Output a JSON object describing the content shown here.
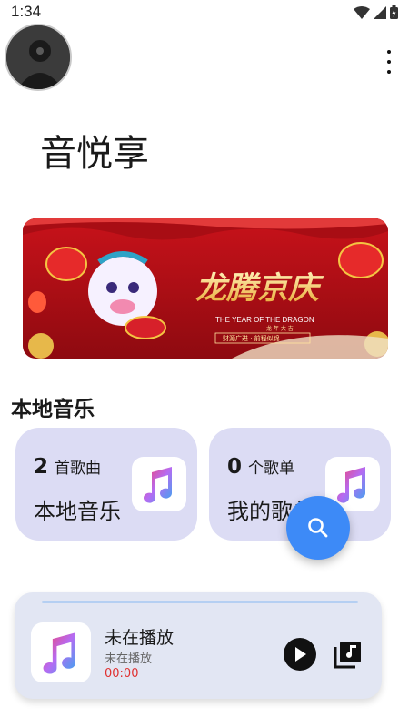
{
  "status_bar": {
    "time": "1:34"
  },
  "header": {
    "app_title": "音悦享"
  },
  "banner": {
    "headline": "龙腾京庆",
    "subtitle_en": "THE YEAR OF THE DRAGON",
    "subtitle_cn": "龙 年 大 吉",
    "slogan": "财源广进 · 前程似锦"
  },
  "local_section": {
    "title": "本地音乐",
    "cards": [
      {
        "count": "2",
        "unit": "首歌曲",
        "label": "本地音乐"
      },
      {
        "count": "0",
        "unit": "个歌单",
        "label": "我的歌单"
      }
    ]
  },
  "player": {
    "title": "未在播放",
    "subtitle": "未在播放",
    "time": "00:00",
    "progress": 0
  },
  "colors": {
    "card_bg": "#dcdcf4",
    "fab": "#3d8af7",
    "player_bg": "#e2e6f3",
    "time_red": "#e03030"
  },
  "icons": [
    "signal-icon",
    "wifi-icon",
    "battery-icon",
    "avatar-icon",
    "more-vert-icon",
    "music-note-icon",
    "search-icon",
    "play-icon",
    "playlist-icon"
  ]
}
